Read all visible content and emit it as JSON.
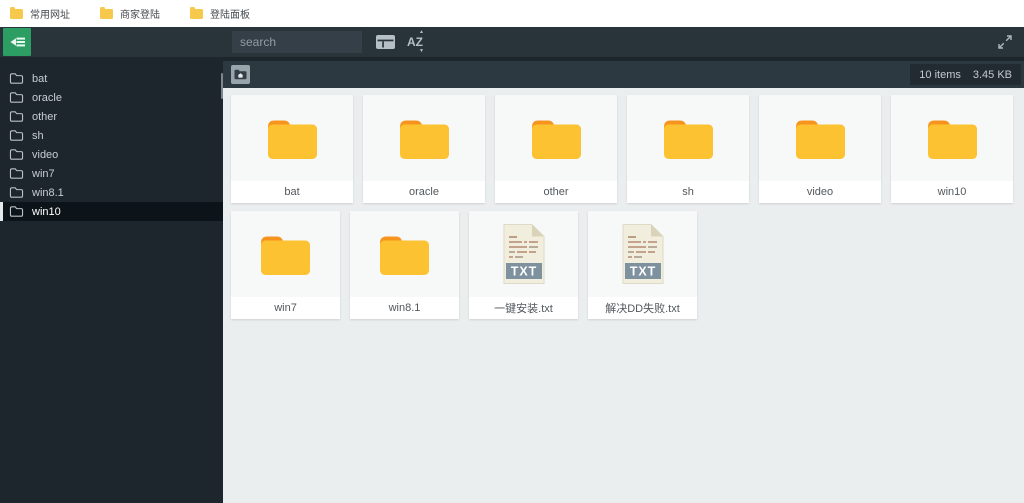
{
  "bookmarks_bar": {
    "items": [
      {
        "label": "常用网址"
      },
      {
        "label": "商家登陆"
      },
      {
        "label": "登陆面板"
      }
    ]
  },
  "toolbar": {
    "search_placeholder": "search"
  },
  "sidebar": {
    "items": [
      {
        "label": "bat",
        "selected": false
      },
      {
        "label": "oracle",
        "selected": false
      },
      {
        "label": "other",
        "selected": false
      },
      {
        "label": "sh",
        "selected": false
      },
      {
        "label": "video",
        "selected": false
      },
      {
        "label": "win7",
        "selected": false
      },
      {
        "label": "win8.1",
        "selected": false
      },
      {
        "label": "win10",
        "selected": true
      }
    ]
  },
  "path_bar": {
    "status": {
      "items_count": "10 items",
      "total_size": "3.45 KB"
    }
  },
  "file_grid": {
    "items": [
      {
        "name": "bat",
        "type": "folder"
      },
      {
        "name": "oracle",
        "type": "folder"
      },
      {
        "name": "other",
        "type": "folder"
      },
      {
        "name": "sh",
        "type": "folder"
      },
      {
        "name": "video",
        "type": "folder"
      },
      {
        "name": "win10",
        "type": "folder"
      },
      {
        "name": "win7",
        "type": "folder"
      },
      {
        "name": "win8.1",
        "type": "folder"
      },
      {
        "name": "一键安装.txt",
        "type": "txt"
      },
      {
        "name": "解决DD失败.txt",
        "type": "txt"
      }
    ]
  },
  "icons": {
    "txt_badge": "TXT"
  },
  "colors": {
    "accent_green": "#2d9e63",
    "folder_yellow": "#fdc232",
    "folder_tab_orange": "#f7941d",
    "txt_banner": "#7e919e",
    "toolbar_bg": "#28333a",
    "sidebar_bg": "#1d262d",
    "content_bg": "#ebeeee"
  }
}
